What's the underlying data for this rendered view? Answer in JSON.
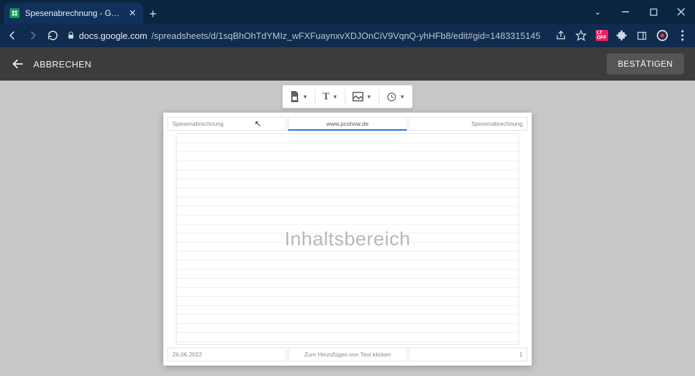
{
  "browser": {
    "tab_title": "Spesenabrechnung - Google Tab",
    "url_domain": "docs.google.com",
    "url_path": "/spreadsheets/d/1sqBhOhTdYMIz_wFXFuaynxvXDJOnCiV9VqnQ-yhHFb8/edit#gid=1483315145",
    "ext_badge": "OFF"
  },
  "actionbar": {
    "cancel": "ABBRECHEN",
    "confirm": "BESTÄTIGEN"
  },
  "doc": {
    "header_left": "Spesenabrechnung",
    "header_center": "www.pcshow.de",
    "header_right": "Spesenabrechnung",
    "grid_placeholder": "Inhaltsbereich",
    "footer_left": "26.06.2022",
    "footer_center": "Zum Hinzufügen von Text klicken",
    "footer_right": "1"
  }
}
